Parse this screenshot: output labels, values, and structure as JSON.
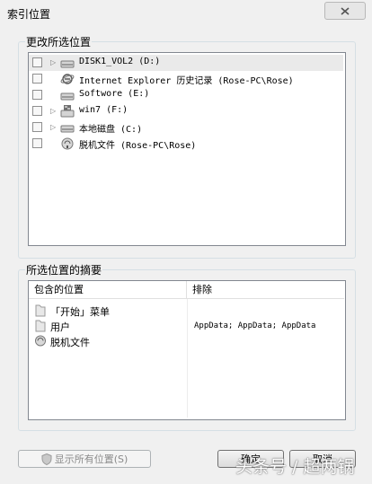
{
  "window": {
    "title": "索引位置",
    "close_label": "X"
  },
  "change_locations": {
    "group_label": "更改所选位置",
    "rows": [
      {
        "label": "DISK1_VOL2 (D:)",
        "icon": "drive-icon",
        "expandable": true,
        "checked": false,
        "selected": true
      },
      {
        "label": "Internet Explorer 历史记录 (Rose-PC\\Rose)",
        "icon": "internet-explorer-icon",
        "expandable": false,
        "checked": false
      },
      {
        "label": "Softwore (E:)",
        "icon": "drive-icon",
        "expandable": false,
        "checked": false
      },
      {
        "label": "win7 (F:)",
        "icon": "system-drive-icon",
        "expandable": true,
        "checked": false
      },
      {
        "label": "本地磁盘 (C:)",
        "icon": "drive-icon",
        "expandable": true,
        "checked": false
      },
      {
        "label": "脱机文件 (Rose-PC\\Rose)",
        "icon": "offline-files-icon",
        "expandable": false,
        "checked": false
      }
    ]
  },
  "summary": {
    "group_label": "所选位置的摘要",
    "col_included": "包含的位置",
    "col_excluded": "排除",
    "included": [
      {
        "label": "「开始」菜单",
        "icon": "folder-icon"
      },
      {
        "label": "用户",
        "icon": "folder-icon"
      },
      {
        "label": "脱机文件",
        "icon": "offline-files-icon"
      }
    ],
    "excluded": "AppData; AppData; AppData"
  },
  "buttons": {
    "show_all": "显示所有位置(S)",
    "ok": "确定",
    "cancel": "取消"
  },
  "watermark": "头条号 / 超两锅",
  "colors": {
    "background": "#f0f0f0",
    "selected_row": "#eaeaea",
    "list_border": "#828790"
  }
}
